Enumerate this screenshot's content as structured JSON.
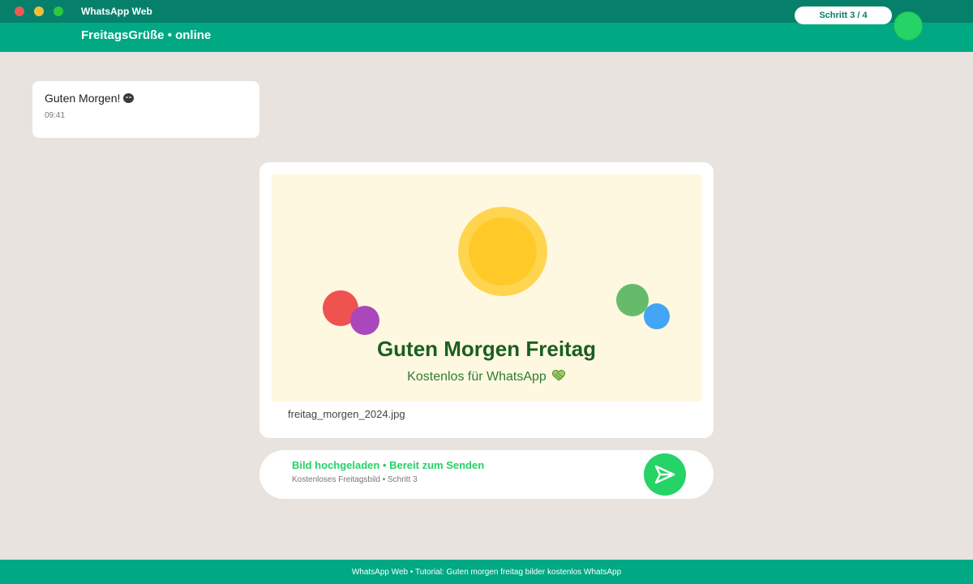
{
  "window": {
    "app_title": "WhatsApp Web"
  },
  "header": {
    "chat_title": "FreitagsGrüße • online",
    "step_pill": "Schritt 3 / 4"
  },
  "message": {
    "text": "Guten Morgen!",
    "emoji_icon": "sleepy-face-icon",
    "time": "09:41"
  },
  "image_card": {
    "headline": "Guten Morgen Freitag",
    "subline": "Kostenlos für WhatsApp",
    "heart_icon": "green-heart-icon",
    "file_name": "freitag_morgen_2024.jpg"
  },
  "status": {
    "title": "Bild hochgeladen • Bereit zum Senden",
    "subtitle": "Kostenloses Freitagsbild • Schritt 3",
    "send_icon": "send-icon"
  },
  "footer": {
    "text": "WhatsApp Web • Tutorial: Guten morgen freitag bilder kostenlos WhatsApp"
  },
  "colors": {
    "titlebar": "#06806b",
    "header": "#00a884",
    "accent": "#25d366",
    "background": "#e8e3df",
    "headline": "#1b5e20"
  }
}
